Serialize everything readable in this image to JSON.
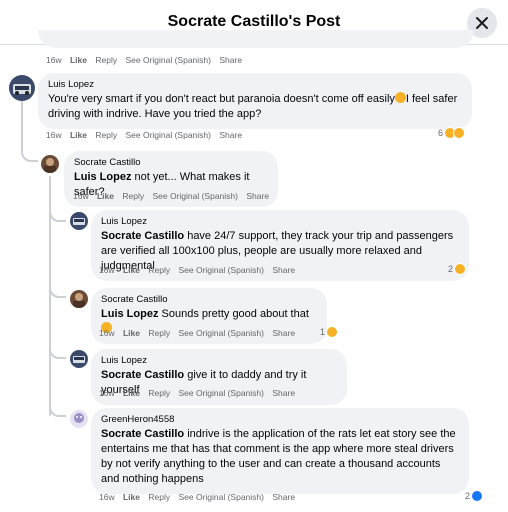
{
  "header": {
    "title": "Socrate Castillo's Post"
  },
  "prev_comment_actions": {
    "time": "16w",
    "like": "Like",
    "reply": "Reply",
    "see_original": "See Original (Spanish)",
    "share": "Share"
  },
  "comments": [
    {
      "author": "Luis Lopez",
      "mention": "",
      "text": "You're very smart if you don't react but paranoia doesn't come off easily",
      "text_after_emoji": "I feel safer driving with indrive. Have you tried the app?",
      "time": "16w",
      "like": "Like",
      "reply": "Reply",
      "see_original": "See Original (Spanish)",
      "share": "Share",
      "reaction_count": "6"
    },
    {
      "author": "Socrate Castillo",
      "mention": "Luis Lopez",
      "text": " not yet... What makes it safer?",
      "time": "16w",
      "like": "Like",
      "reply": "Reply",
      "see_original": "See Original (Spanish)",
      "share": "Share"
    },
    {
      "author": "Luis Lopez",
      "mention": "Socrate Castillo",
      "text": " have 24/7 support, they track your trip and passengers are verified all 100x100 plus, people are usually more relaxed and judgmental",
      "time": "16w",
      "like": "Like",
      "reply": "Reply",
      "see_original": "See Original (Spanish)",
      "share": "Share",
      "reaction_count": "2"
    },
    {
      "author": "Socrate Castillo",
      "mention": "Luis Lopez",
      "text": " Sounds pretty good about that",
      "time": "16w",
      "like": "Like",
      "reply": "Reply",
      "see_original": "See Original (Spanish)",
      "share": "Share",
      "reaction_count": "1"
    },
    {
      "author": "Luis Lopez",
      "mention": "Socrate Castillo",
      "text": " give it to daddy and try it yourself",
      "time": "16w",
      "like": "Like",
      "reply": "Reply",
      "see_original": "See Original (Spanish)",
      "share": "Share"
    },
    {
      "author": "GreenHeron4558",
      "mention": "Socrate Castillo",
      "text": " indrive is the application of the rats let eat story see the entertains me that has that comment is the app where more steal drivers by not verify anything to the user and can create a thousand accounts and nothing happens",
      "time": "16w",
      "like": "Like",
      "reply": "Reply",
      "see_original": "See Original (Spanish)",
      "share": "Share",
      "reaction_count": "2"
    }
  ],
  "colors": {
    "bubble": "#f0f2f5",
    "meta": "#65676b",
    "thread_line": "#ccd0d5",
    "like_blue": "#1877f2",
    "haha_yellow": "#f7b125"
  },
  "icons": {
    "close": "close-icon",
    "haha": "haha-reaction-icon",
    "like": "like-reaction-icon",
    "grin": "grinning-emoji-icon"
  }
}
